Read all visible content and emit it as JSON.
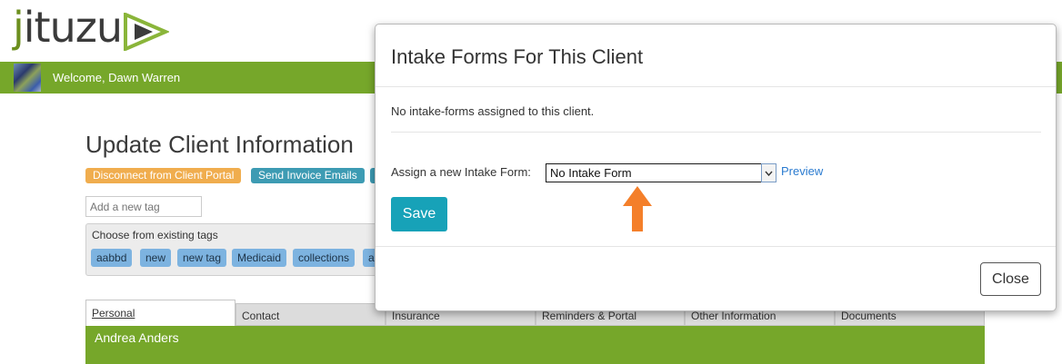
{
  "brand": {
    "logo_j": "j",
    "logo_rest": "ituzu",
    "accent_green": "#76a72a",
    "logo_green": "#6c8f1e"
  },
  "header": {
    "welcome": "Welcome, Dawn Warren",
    "avatar_icon": "user-avatar-icon"
  },
  "page": {
    "title": "Update Client Information",
    "buttons": {
      "disconnect": "Disconnect from Client Portal",
      "send_invoice": "Send Invoice Emails"
    },
    "tag_input_placeholder": "Add a new tag",
    "existing_tags_label": "Choose from existing tags",
    "tags": [
      "aabbd",
      "new",
      "new tag",
      "Medicaid",
      "collections",
      "a"
    ],
    "tabs": [
      "Personal",
      "Contact",
      "Insurance",
      "Reminders & Portal",
      "Other Information",
      "Documents"
    ],
    "client_name": "Andrea Anders"
  },
  "modal": {
    "title": "Intake Forms For This Client",
    "empty_message": "No intake-forms assigned to this client.",
    "assign_label": "Assign a new Intake Form:",
    "select_value": "No Intake Form",
    "preview_link": "Preview",
    "save_label": "Save",
    "close_label": "Close",
    "arrow_color": "#f47f2a",
    "save_color": "#17a2b8"
  }
}
